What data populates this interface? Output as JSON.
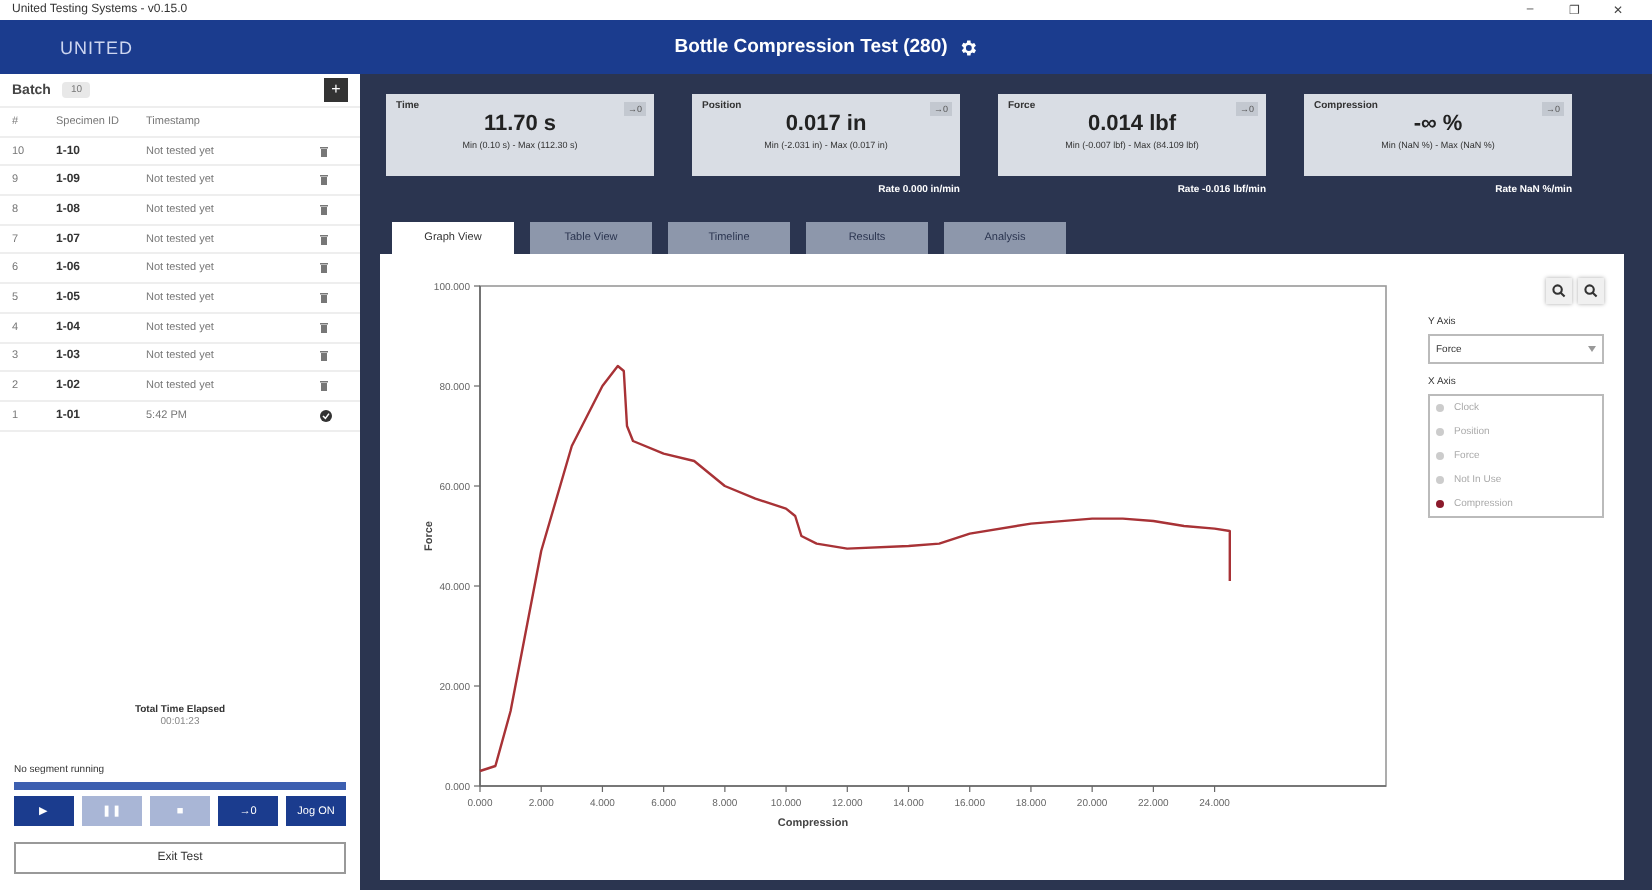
{
  "window": {
    "title": "United Testing Systems - v0.15.0",
    "controls": [
      "–",
      "❐",
      "✕"
    ]
  },
  "header": {
    "logo": "UNITED",
    "title": "Bottle Compression Test (280)"
  },
  "batch": {
    "label": "Batch",
    "count": "10",
    "add": "+",
    "columns": [
      "#",
      "Specimen ID",
      "Timestamp"
    ],
    "rows": [
      {
        "num": "10",
        "id": "1-10",
        "timestamp": "Not tested yet",
        "tested": false
      },
      {
        "num": "9",
        "id": "1-09",
        "timestamp": "Not tested yet",
        "tested": false
      },
      {
        "num": "8",
        "id": "1-08",
        "timestamp": "Not tested yet",
        "tested": false
      },
      {
        "num": "7",
        "id": "1-07",
        "timestamp": "Not tested yet",
        "tested": false
      },
      {
        "num": "6",
        "id": "1-06",
        "timestamp": "Not tested yet",
        "tested": false
      },
      {
        "num": "5",
        "id": "1-05",
        "timestamp": "Not tested yet",
        "tested": false
      },
      {
        "num": "4",
        "id": "1-04",
        "timestamp": "Not tested yet",
        "tested": false
      },
      {
        "num": "3",
        "id": "1-03",
        "timestamp": "Not tested yet",
        "tested": false
      },
      {
        "num": "2",
        "id": "1-02",
        "timestamp": "Not tested yet",
        "tested": false
      },
      {
        "num": "1",
        "id": "1-01",
        "timestamp": "5:42 PM",
        "tested": true
      }
    ]
  },
  "elapsed": {
    "label": "Total Time Elapsed",
    "value": "00:01:23"
  },
  "segment": {
    "status": "No segment running",
    "level": 1
  },
  "controls": [
    {
      "label": "▶",
      "disabled": false
    },
    {
      "label": "❚❚",
      "disabled": true
    },
    {
      "label": "■",
      "disabled": true
    },
    {
      "label": "→0",
      "disabled": false
    },
    {
      "label": "Jog ON",
      "disabled": false
    }
  ],
  "exit": "Exit Test",
  "readouts": [
    {
      "name": "Time",
      "value": "11.70 s",
      "range": "Min (0.10 s) - Max (112.30 s)",
      "zero": "→0"
    },
    {
      "name": "Position",
      "value": "0.017 in",
      "range": "Min (-2.031 in) - Max (0.017 in)",
      "zero": "→0",
      "rate": "Rate 0.000 in/min"
    },
    {
      "name": "Force",
      "value": "0.014 lbf",
      "range": "Min (-0.007 lbf) - Max (84.109 lbf)",
      "zero": "→0",
      "rate": "Rate -0.016 lbf/min"
    },
    {
      "name": "Compression",
      "value": "-∞ %",
      "range": "Min (NaN %) - Max (NaN %)",
      "zero": "→0",
      "rate": "Rate NaN %/min"
    }
  ],
  "tabs": [
    {
      "label": "Graph View",
      "selected": true
    },
    {
      "label": "Table View",
      "selected": false
    },
    {
      "label": "Timeline",
      "selected": false
    },
    {
      "label": "Results",
      "selected": false
    },
    {
      "label": "Analysis",
      "selected": false
    }
  ],
  "graph": {
    "y_axis_label": "Y Axis",
    "y_axis_value": "Force",
    "x_axis_label": "X Axis",
    "x_options": [
      {
        "label": "Clock",
        "selected": false
      },
      {
        "label": "Position",
        "selected": false
      },
      {
        "label": "Force",
        "selected": false
      },
      {
        "label": "Not In Use",
        "selected": false
      },
      {
        "label": "Compression",
        "selected": true
      }
    ],
    "chart_data": {
      "type": "line",
      "xlabel": "Compression",
      "ylabel": "Force",
      "xlim": [
        0,
        29.6
      ],
      "ylim": [
        0,
        100
      ],
      "xticks": [
        {
          "value": 0,
          "label": "0.000"
        },
        {
          "value": 2,
          "label": "2.000"
        },
        {
          "value": 4,
          "label": "4.000"
        },
        {
          "value": 6,
          "label": "6.000"
        },
        {
          "value": 8,
          "label": "8.000"
        },
        {
          "value": 10,
          "label": "10.000"
        },
        {
          "value": 12,
          "label": "12.000"
        },
        {
          "value": 14,
          "label": "14.000"
        },
        {
          "value": 16,
          "label": "16.000"
        },
        {
          "value": 18,
          "label": "18.000"
        },
        {
          "value": 20,
          "label": "20.000"
        },
        {
          "value": 22,
          "label": "22.000"
        },
        {
          "value": 24,
          "label": "24.000"
        }
      ],
      "yticks": [
        {
          "value": 0,
          "label": "0.000"
        },
        {
          "value": 20,
          "label": "20.000"
        },
        {
          "value": 40,
          "label": "40.000"
        },
        {
          "value": 60,
          "label": "60.000"
        },
        {
          "value": 80,
          "label": "80.000"
        },
        {
          "value": 100,
          "label": "100.000"
        }
      ],
      "x": [
        0,
        0.5,
        1,
        2,
        3,
        4,
        4.5,
        4.7,
        4.8,
        5,
        6,
        7,
        8,
        9,
        10,
        10.3,
        10.5,
        11,
        12,
        14,
        15,
        16,
        18,
        20,
        21,
        22,
        23,
        24,
        24.5,
        24.5
      ],
      "series": [
        {
          "color": "#a83236",
          "values": [
            3,
            4,
            15,
            47,
            68,
            80,
            84,
            83,
            72,
            69,
            66.5,
            65,
            60,
            57.5,
            55.5,
            54,
            50,
            48.5,
            47.5,
            48,
            48.5,
            50.5,
            52.5,
            53.5,
            53.5,
            53,
            52,
            51.5,
            51,
            41
          ]
        }
      ]
    }
  }
}
